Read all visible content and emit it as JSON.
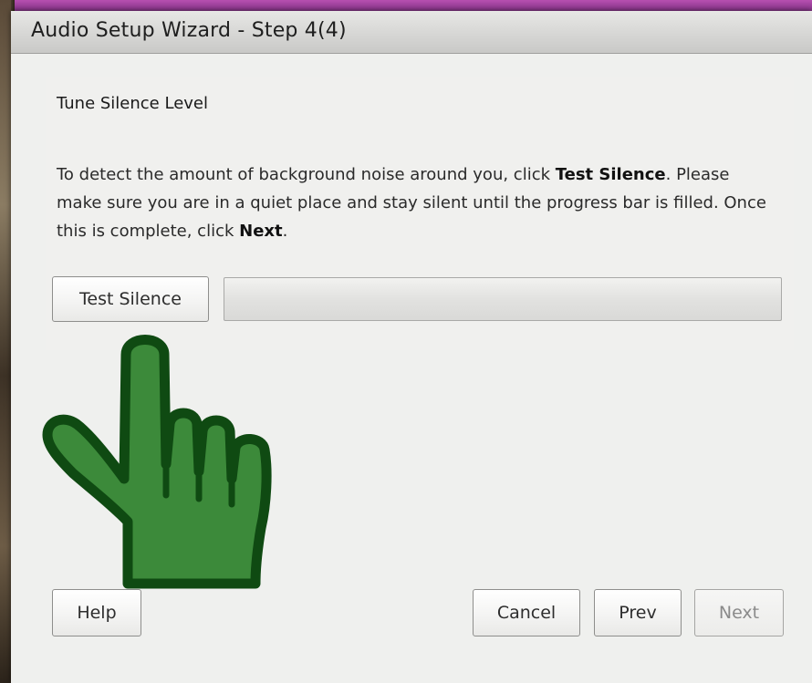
{
  "window": {
    "title": "Audio Setup Wizard - Step 4(4)"
  },
  "section": {
    "heading": "Tune Silence Level",
    "instructions": {
      "part1": "To detect the amount of background noise around you, click ",
      "bold1": "Test Silence",
      "part2": ". Please make sure you are in a quiet place and stay silent until the progress bar is filled. Once this is complete, click ",
      "bold2": "Next",
      "part3": "."
    }
  },
  "test_button": {
    "label": "Test Silence"
  },
  "progress": {
    "value": 0
  },
  "footer": {
    "help_label": "Help",
    "cancel_label": "Cancel",
    "prev_label": "Prev",
    "next_label": "Next",
    "next_enabled": false
  },
  "overlay": {
    "pointer": "pointing-hand-icon",
    "pointer_color": "#3c8a3a"
  },
  "colors": {
    "window_bg": "#eff0ee",
    "titlebar_bg": "#d5d5d3",
    "disabled_text": "#8a8a8a"
  }
}
